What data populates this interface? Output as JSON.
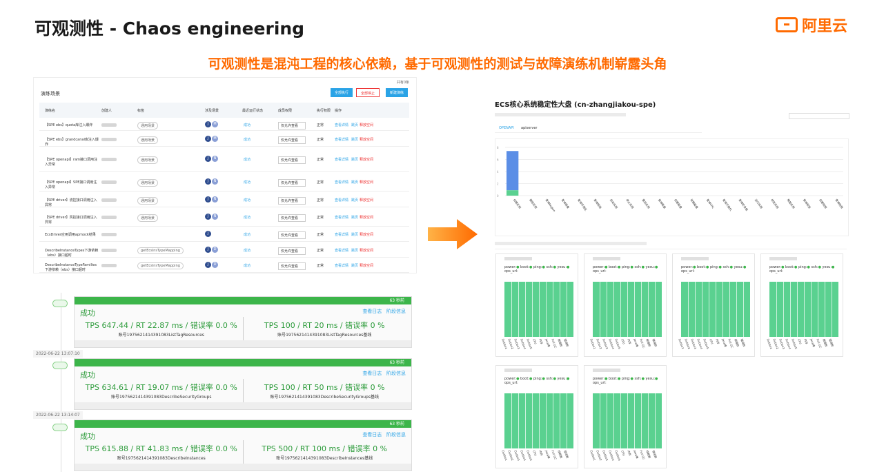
{
  "slide": {
    "title": "可观测性 - Chaos engineering",
    "logo_text": "阿里云",
    "subtitle": "可观测性是混沌工程的核心依赖，基于可观测性的测试与故障演练机制崭露头角",
    "accent_color": "#ff6a00"
  },
  "drill_table": {
    "panel_title": "演练场景",
    "total": "共有0条",
    "buttons": [
      "全部执行",
      "全部停止",
      "新建演练"
    ],
    "columns": [
      "演练名",
      "创建人",
      "标签",
      "涉及场景",
      "最近运行状态",
      "成员权限",
      "执行权限",
      "操作"
    ],
    "rows": [
      {
        "name": "【SPE ebs】quota库注入爆炸",
        "tag": "通用场景",
        "avatars": [
          "J",
          "M"
        ],
        "status": "成功",
        "perm": "仅允许查看",
        "exec": "正常",
        "ops": [
          "查看详情",
          "跳页",
          "释放空间"
        ]
      },
      {
        "name": "【SPE ebs】grandcanal库注入爆炸",
        "tag": "通用场景",
        "avatars": [
          "J",
          "M"
        ],
        "status": "成功",
        "perm": "仅允许查看",
        "exec": "正常",
        "ops": [
          "查看详情",
          "跳页",
          "释放空间"
        ]
      },
      {
        "name": "【SPE openapi】ram接口调用注入异常",
        "tag": "通用场景",
        "avatars": [
          "J",
          "N"
        ],
        "status": "成功",
        "perm": "仅允许查看",
        "exec": "正常",
        "ops": [
          "查看详情",
          "跳页",
          "释放空间"
        ]
      },
      {
        "name": "【SPE openapi】SPE接口调用注入异常",
        "tag": "通用场景",
        "avatars": [
          "J",
          "N"
        ],
        "status": "成功",
        "perm": "仅允许查看",
        "exec": "正常",
        "ops": [
          "查看详情",
          "跳页",
          "释放空间"
        ]
      },
      {
        "name": "【SPE driver】流控接口调用注入异常",
        "tag": "通用场景",
        "avatars": [
          "J",
          "N"
        ],
        "status": "成功",
        "perm": "仅允许查看",
        "exec": "正常",
        "ops": [
          "查看详情",
          "跳页",
          "释放空间"
        ]
      },
      {
        "name": "【SPE driver】风控接口调用注入异常",
        "tag": "通用场景",
        "avatars": [
          "J",
          "N"
        ],
        "status": "成功",
        "perm": "仅允许查看",
        "exec": "正常",
        "ops": [
          "查看详情",
          "跳页",
          "释放空间"
        ]
      },
      {
        "name": "EcsDriver应用调用apmock结果",
        "tag": "",
        "avatars": [
          "J"
        ],
        "status": "成功",
        "perm": "仅允许查看",
        "exec": "正常",
        "ops": [
          "查看详情",
          "跳页",
          "释放空间"
        ]
      },
      {
        "name": "DescribeInstanceTypes下游依赖（ebs）接口超时",
        "tag": "getEcsInsTypeMapping",
        "avatars": [
          "J",
          "D"
        ],
        "status": "成功",
        "perm": "仅允许查看",
        "exec": "正常",
        "ops": [
          "查看详情",
          "跳页",
          "释放空间"
        ]
      },
      {
        "name": "DescribeInstanceTypeFamilies下游依赖（ebs）接口超时",
        "tag": "getEcsInsTypeMapping",
        "avatars": [
          "J",
          "D"
        ],
        "status": "成功",
        "perm": "仅允许查看",
        "exec": "正常",
        "ops": [
          "查看详情",
          "跳页",
          "释放空间"
        ]
      }
    ]
  },
  "runs": [
    {
      "duration": "63 秒前",
      "status": "成功",
      "links": [
        "查看日志",
        "阶段信息"
      ],
      "left_metric": "TPS 647.44 / RT 22.87 ms / 错误率 0.0 %",
      "left_acct": "账号1975621414391083ListTagResources",
      "right_metric": "TPS 100 / RT 20 ms / 错误率 0 %",
      "right_acct": "账号1975621414391083ListTagResources基线"
    },
    {
      "timestamp": "2022-06-22 13:07:10",
      "duration": "63 秒前",
      "status": "成功",
      "links": [
        "查看日志",
        "阶段信息"
      ],
      "left_metric": "TPS 634.61 / RT 19.07 ms / 错误率 0.0 %",
      "left_acct": "账号1975621414391083DescribeSecurityGroups",
      "right_metric": "TPS 100 / RT 50 ms / 错误率 0 %",
      "right_acct": "账号1975621414391083DescribeSecurityGroups基线"
    },
    {
      "timestamp": "2022-06-22 13:14:07",
      "duration": "63 秒前",
      "status": "成功",
      "links": [
        "查看日志",
        "阶段信息"
      ],
      "left_metric": "TPS 615.88 / RT 41.83 ms / 错误率 0.0 %",
      "left_acct": "账号1975621414391083DescribeInstances",
      "right_metric": "TPS 500 / RT 100 ms / 错误率 0 %",
      "right_acct": "账号1975621414391083DescribeInstances基线"
    }
  ],
  "dashboard": {
    "title": "ECS核心系统稳定性大盘 (cn-zhangjiakou-spe)",
    "tabs": [
      "OPENAPI",
      "apiserver"
    ],
    "legend_items": [
      "power:",
      "boot:",
      "ping:",
      "ssh:",
      "yesu:"
    ],
    "ops_label": "ops_url:",
    "mini_labels": [
      "Dubbo1",
      "Dubbo2",
      "Dubbo3",
      "Dubbo4",
      "Dubbo5",
      "CPU",
      "内存",
      "Java堆",
      "Full GC",
      "线程数",
      "错误数"
    ]
  },
  "chart_data": {
    "type": "bar",
    "categories": [
      "创建实例",
      "删除实例",
      "查询Region",
      "查询镜像",
      "查询可用区",
      "查询规格",
      "启动实例",
      "停止实例",
      "重启实例",
      "查询磁盘",
      "创建磁盘",
      "挂载磁盘",
      "查询VPC",
      "查询交换机",
      "查询安全组",
      "运行实例",
      "修改实例",
      "释放实例",
      "查询标签",
      "创建快照",
      "查询快照"
    ],
    "values": [
      7.4,
      0,
      0,
      0,
      0,
      0,
      0,
      0,
      0,
      0,
      0,
      0,
      0,
      0,
      0,
      0,
      0,
      0,
      0,
      0,
      0
    ],
    "ylim": [
      0,
      8
    ],
    "yticks": [
      0,
      2,
      4,
      6,
      8
    ],
    "grid": true
  }
}
